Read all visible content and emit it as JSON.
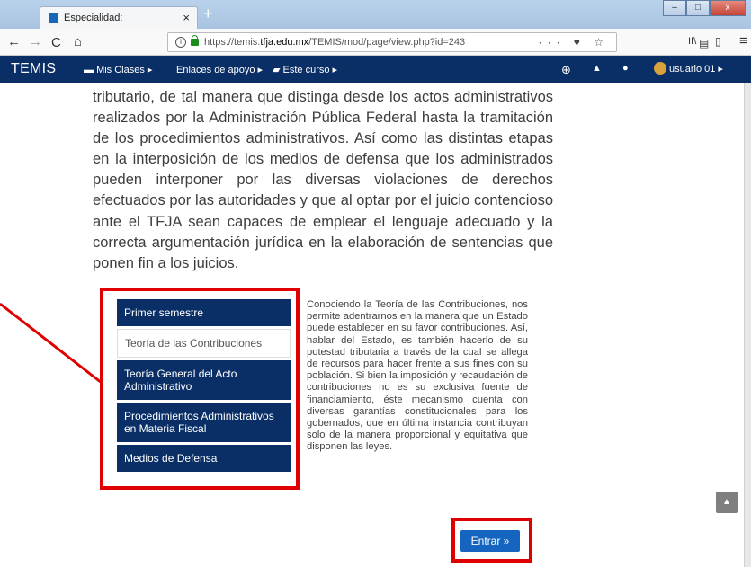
{
  "browser": {
    "tab_title": "Especialidad:",
    "tab_close": "×",
    "new_tab": "+",
    "url_info": "i",
    "url_prefix": "https://temis.",
    "url_host": "tfja.edu.mx",
    "url_path": "/TEMIS/mod/page/view.php?id=243",
    "url_actions": "··· ♥ ☆",
    "reader_icon": "▤",
    "back_icon": "←",
    "forward_icon": "→",
    "reload_icon": "C",
    "home_icon": "⌂",
    "library_icon": "II\\",
    "sidebar_icon": "▯",
    "menu_icon": "≡",
    "minimize": "–",
    "maximize": "□",
    "close": "x"
  },
  "site": {
    "brand": "TEMIS",
    "menu": [
      {
        "label": "Mis Clases ▸",
        "icon": "grad-cap-icon"
      },
      {
        "label": "Enlaces de apoyo ▸"
      },
      {
        "label": "Este curso ▸",
        "icon": "book-icon"
      }
    ],
    "icons": [
      "⊕",
      "▲",
      "●"
    ],
    "user": "usuario 01 ▸"
  },
  "content": {
    "paragraph": "tributario, de tal manera que distinga desde los actos administrativos realizados por la Administración Pública Federal hasta la tramitación de los procedimientos administrativos. Así como las distintas etapas en la interposición de los medios de defensa que los administrados pueden interponer por las diversas violaciones de derechos efectuados por las autoridades y que al optar por el juicio contencioso ante el TFJA sean capaces de emplear el lenguaje adecuado y la correcta argumentación jurídica en la elaboración de sentencias que ponen fin a los juicios.",
    "menu_buttons": [
      {
        "label": "Primer semestre",
        "style": "dark"
      },
      {
        "label": "Teoría de las Contribuciones",
        "style": "light"
      },
      {
        "label": "Teoría General del Acto Administrativo",
        "style": "dark"
      },
      {
        "label": "Procedimientos Administrativos en Materia Fiscal",
        "style": "dark"
      },
      {
        "label": "Medios de Defensa",
        "style": "dark"
      }
    ],
    "side_text": "Conociendo la Teoría de las Contribuciones, nos permite adentrarnos en la manera que un Estado puede establecer en su favor contribuciones. Así, hablar del Estado, es también hacerlo de su potestad tributaria a través de la cual se allega de recursos para hacer frente a sus fines con su población. Si bien la imposición y recaudación de contribuciones no es su exclusiva fuente de financiamiento, éste mecanismo cuenta con diversas garantías constitucionales para los gobernados, que en última instancia contribuyan solo de la manera proporcional y equitativa que disponen las leyes.",
    "enter_label": "Entrar »",
    "scroll_top": "▲"
  },
  "colors": {
    "nav_dark": "#0a2f66",
    "button_blue": "#1565c0",
    "highlight_red": "#e00000"
  }
}
